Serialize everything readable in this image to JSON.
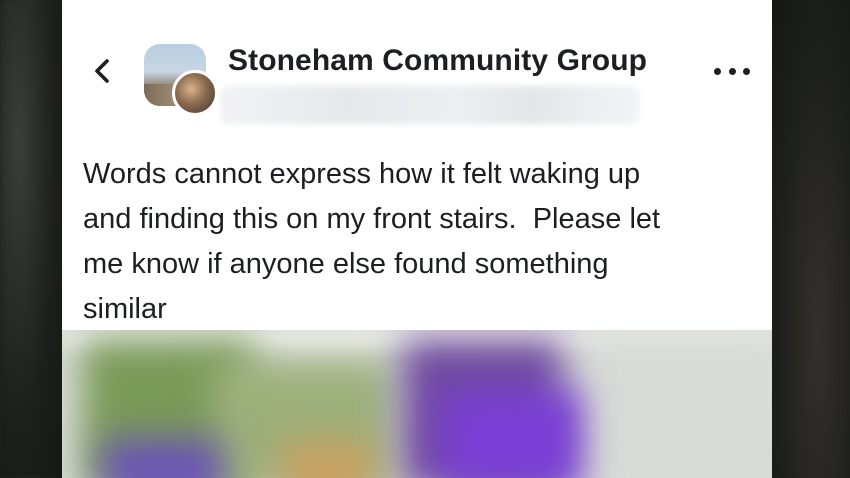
{
  "header": {
    "group_name": "Stoneham Community Group",
    "back_icon": "chevron-left-icon",
    "more_icon": "more-horizontal-icon"
  },
  "post": {
    "text": "Words cannot express how it felt waking up\nand finding this on my front stairs.  Please let\nme know if anyone else found something\nsimilar"
  },
  "colors": {
    "text": "#1c1e21",
    "background": "#ffffff"
  }
}
